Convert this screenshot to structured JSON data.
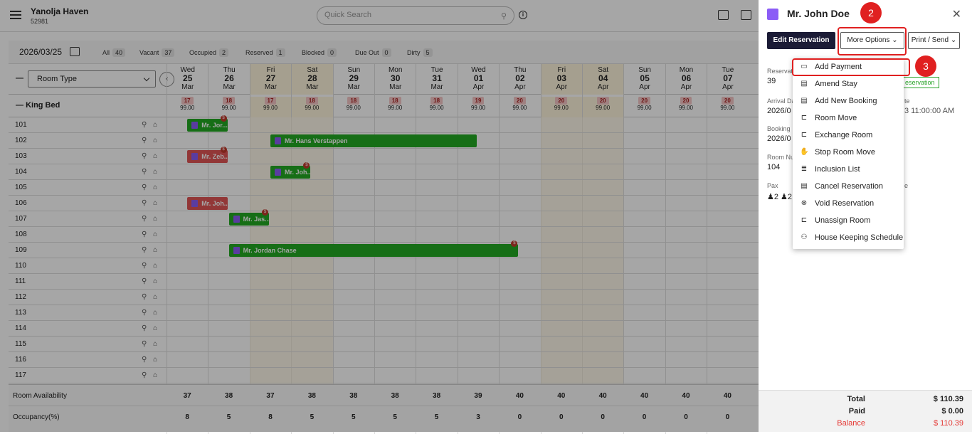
{
  "header": {
    "hotel_name": "Yanolja Haven",
    "hotel_code": "52981",
    "search_placeholder": "Quick Search"
  },
  "filters": {
    "date": "2026/03/25",
    "items": [
      {
        "label": "All",
        "count": "40"
      },
      {
        "label": "Vacant",
        "count": "37"
      },
      {
        "label": "Occupied",
        "count": "2"
      },
      {
        "label": "Reserved",
        "count": "1"
      },
      {
        "label": "Blocked",
        "count": "0"
      },
      {
        "label": "Due Out",
        "count": "0"
      },
      {
        "label": "Dirty",
        "count": "5"
      }
    ]
  },
  "grid": {
    "room_type_label": "Room Type",
    "dash": "—",
    "section": "King Bed",
    "days": [
      {
        "dow": "Wed",
        "d": "25",
        "m": "Mar",
        "avail": "17",
        "price": "99.00",
        "ra": "37",
        "occ": "8",
        "weekend": false
      },
      {
        "dow": "Thu",
        "d": "26",
        "m": "Mar",
        "avail": "18",
        "price": "99.00",
        "ra": "38",
        "occ": "5",
        "weekend": false
      },
      {
        "dow": "Fri",
        "d": "27",
        "m": "Mar",
        "avail": "17",
        "price": "99.00",
        "ra": "37",
        "occ": "8",
        "weekend": true
      },
      {
        "dow": "Sat",
        "d": "28",
        "m": "Mar",
        "avail": "18",
        "price": "99.00",
        "ra": "38",
        "occ": "5",
        "weekend": true
      },
      {
        "dow": "Sun",
        "d": "29",
        "m": "Mar",
        "avail": "18",
        "price": "99.00",
        "ra": "38",
        "occ": "5",
        "weekend": false
      },
      {
        "dow": "Mon",
        "d": "30",
        "m": "Mar",
        "avail": "18",
        "price": "99.00",
        "ra": "38",
        "occ": "5",
        "weekend": false
      },
      {
        "dow": "Tue",
        "d": "31",
        "m": "Mar",
        "avail": "18",
        "price": "99.00",
        "ra": "38",
        "occ": "5",
        "weekend": false
      },
      {
        "dow": "Wed",
        "d": "01",
        "m": "Apr",
        "avail": "19",
        "price": "99.00",
        "ra": "39",
        "occ": "3",
        "weekend": false
      },
      {
        "dow": "Thu",
        "d": "02",
        "m": "Apr",
        "avail": "20",
        "price": "99.00",
        "ra": "40",
        "occ": "0",
        "weekend": false
      },
      {
        "dow": "Fri",
        "d": "03",
        "m": "Apr",
        "avail": "20",
        "price": "99.00",
        "ra": "40",
        "occ": "0",
        "weekend": true
      },
      {
        "dow": "Sat",
        "d": "04",
        "m": "Apr",
        "avail": "20",
        "price": "99.00",
        "ra": "40",
        "occ": "0",
        "weekend": true
      },
      {
        "dow": "Sun",
        "d": "05",
        "m": "Apr",
        "avail": "20",
        "price": "99.00",
        "ra": "40",
        "occ": "0",
        "weekend": false
      },
      {
        "dow": "Mon",
        "d": "06",
        "m": "Apr",
        "avail": "20",
        "price": "99.00",
        "ra": "40",
        "occ": "0",
        "weekend": false
      },
      {
        "dow": "Tue",
        "d": "07",
        "m": "Apr",
        "avail": "20",
        "price": "99.00",
        "ra": "40",
        "occ": "0",
        "weekend": false
      }
    ],
    "rooms": [
      "101",
      "102",
      "103",
      "104",
      "105",
      "106",
      "107",
      "108",
      "109",
      "110",
      "111",
      "112",
      "113",
      "114",
      "115",
      "116",
      "117"
    ],
    "bookings": [
      {
        "room": "101",
        "label": "Mr. Jor...",
        "start": 0,
        "nights": 1,
        "color": "green",
        "dot": "$"
      },
      {
        "room": "102",
        "label": "Mr. Hans Verstappen",
        "start": 2,
        "nights": 5,
        "color": "green",
        "dot": ""
      },
      {
        "room": "103",
        "label": "Mr. Zeb...",
        "start": 0,
        "nights": 1,
        "color": "red",
        "dot": "$"
      },
      {
        "room": "104",
        "label": "Mr. Joh...",
        "start": 2,
        "nights": 1,
        "color": "green",
        "dot": "$"
      },
      {
        "room": "106",
        "label": "Mr. Joh...",
        "start": 0,
        "nights": 1,
        "color": "red",
        "dot": ""
      },
      {
        "room": "107",
        "label": "Mr. Jas...",
        "start": 1,
        "nights": 1,
        "color": "green",
        "dot": "$"
      },
      {
        "room": "109",
        "label": "Mr. Jordan Chase",
        "start": 1,
        "nights": 7,
        "color": "green",
        "dot": "$"
      }
    ],
    "footer": {
      "availability_label": "Room Availability",
      "occupancy_label": "Occupancy(%)"
    }
  },
  "panel": {
    "guest_name": "Mr. John Doe",
    "edit_label": "Edit Reservation",
    "more_label": "More Options",
    "print_label": "Print / Send",
    "badge2": "2",
    "badge3": "3",
    "reservation_label": "Reservat",
    "reservation_no": "39",
    "status_tag": "eservation",
    "arrival_label": "Arrival Da",
    "arrival_value": "2026/0",
    "departure_label": "te",
    "departure_value": "3 11:00:00 AM",
    "booking_label": "Booking",
    "booking_value": "2026/0",
    "room_label": "Room Nu",
    "room_value": "104",
    "pax_label": "Pax",
    "pax_value": "2",
    "pax_value2": "2",
    "extra_label": "e",
    "totals": {
      "total_label": "Total",
      "total": "$ 110.39",
      "paid_label": "Paid",
      "paid": "$ 0.00",
      "balance_label": "Balance",
      "balance": "$ 110.39"
    }
  },
  "menu": [
    {
      "label": "Add Payment",
      "icon": "credit-card-icon"
    },
    {
      "label": "Amend Stay",
      "icon": "calendar-edit-icon"
    },
    {
      "label": "Add New Booking",
      "icon": "calendar-add-icon"
    },
    {
      "label": "Room Move",
      "icon": "bed-move-icon"
    },
    {
      "label": "Exchange Room",
      "icon": "bed-exchange-icon"
    },
    {
      "label": "Stop Room Move",
      "icon": "hand-stop-icon"
    },
    {
      "label": "Inclusion List",
      "icon": "list-icon"
    },
    {
      "label": "Cancel Reservation",
      "icon": "calendar-cancel-icon"
    },
    {
      "label": "Void Reservation",
      "icon": "circle-x-icon"
    },
    {
      "label": "Unassign Room",
      "icon": "bed-unassign-icon"
    },
    {
      "label": "House Keeping Schedule",
      "icon": "housekeeping-icon"
    }
  ],
  "colors": {
    "booking_green": "#22aa22",
    "booking_red": "#e05555",
    "highlight": "#e02020",
    "primary_dark": "#1b1b36"
  }
}
